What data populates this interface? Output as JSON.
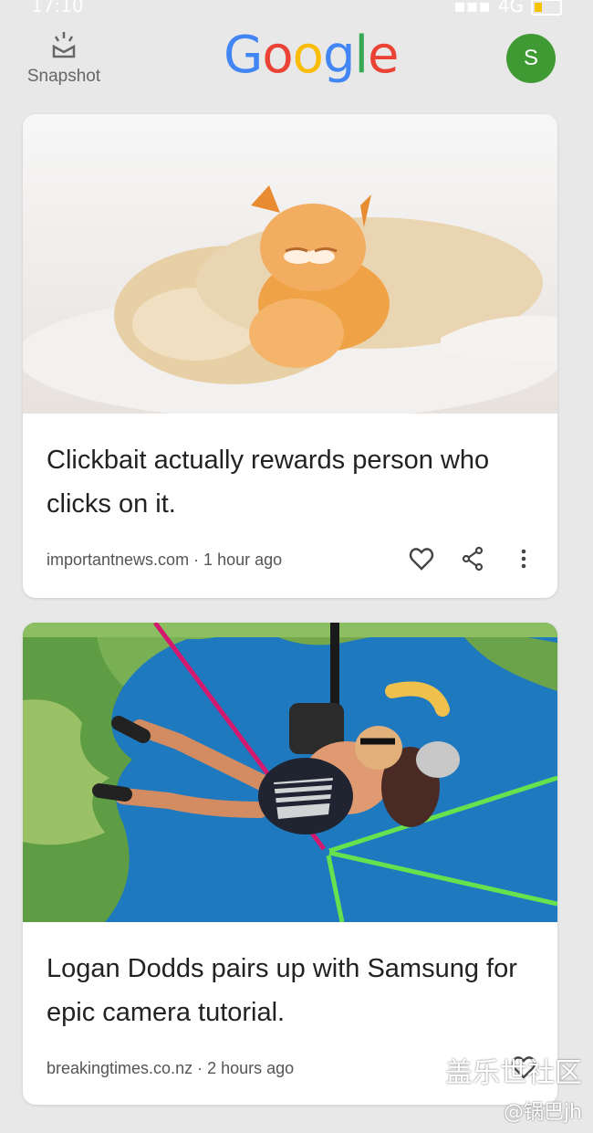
{
  "status_bar": {
    "time": "17:10",
    "network": "4G"
  },
  "header": {
    "snapshot_label": "Snapshot",
    "logo": "Google",
    "avatar_letter": "S"
  },
  "cards": [
    {
      "title": "Clickbait actually rewards person who clicks on it.",
      "meta": "importantnews.com · 1 hour ago",
      "image_name": "puppy-and-kitten-sleeping"
    },
    {
      "title": "Logan Dodds pairs up with Samsung for epic camera tutorial.",
      "meta": "breakingtimes.co.nz · 2 hours ago",
      "image_name": "tandem-paragliding-over-coast"
    }
  ],
  "watermark": {
    "line1": "盖乐世社区",
    "line2": "@锅巴jh"
  }
}
